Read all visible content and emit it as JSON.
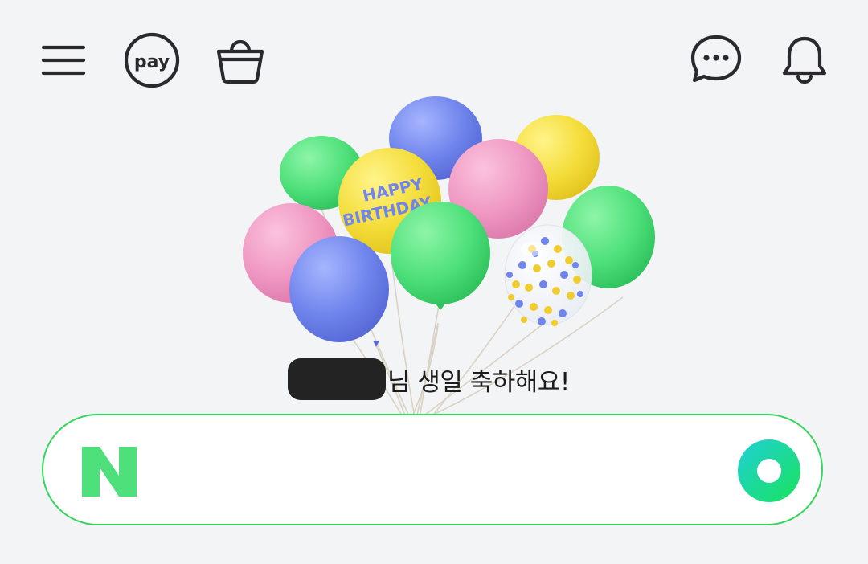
{
  "header": {
    "menu_icon": "hamburger-menu-icon",
    "pay_label": "pay",
    "shopping_icon": "shopping-bag-icon",
    "talk_icon": "chat-bubble-icon",
    "notification_icon": "bell-icon"
  },
  "birthday": {
    "banner_text": "HAPPY BIRTHDAY",
    "message": "님 생일 축하해요!"
  },
  "search": {
    "logo_text": "N",
    "placeholder": "",
    "accent_color": "#03c75a",
    "border_color": "#37d45e"
  }
}
